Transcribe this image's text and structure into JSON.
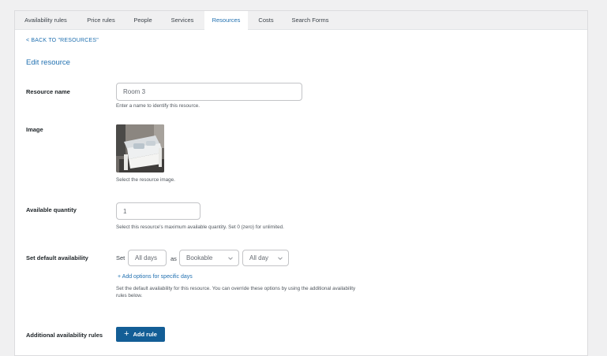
{
  "tabs": [
    {
      "label": "Availability rules"
    },
    {
      "label": "Price rules"
    },
    {
      "label": "People"
    },
    {
      "label": "Services"
    },
    {
      "label": "Resources"
    },
    {
      "label": "Costs"
    },
    {
      "label": "Search Forms"
    }
  ],
  "back_link": "< BACK TO \"RESOURCES\"",
  "edit_title": "Edit resource",
  "resource_name": {
    "label": "Resource name",
    "value": "Room 3",
    "help": "Enter a name to identify this resource."
  },
  "image": {
    "label": "Image",
    "help": "Select the resource image."
  },
  "quantity": {
    "label": "Available quantity",
    "value": "1",
    "help": "Select this resource's maximum available quantity. Set 0 (zero) for unlimited."
  },
  "default_availability": {
    "label": "Set default availability",
    "set_text": "Set",
    "days_value": "All days",
    "as_text": "as",
    "status_value": "Bookable",
    "time_value": "All day",
    "add_options": "+ Add options for specific days",
    "help_line1": "Set the default availability for this resource. You can override these options by using the additional availability",
    "help_line2": "rules below."
  },
  "additional_rules": {
    "label": "Additional availability rules",
    "button_label": "Add rule"
  },
  "colors": {
    "accent": "#2271b1",
    "button": "#135e96"
  }
}
